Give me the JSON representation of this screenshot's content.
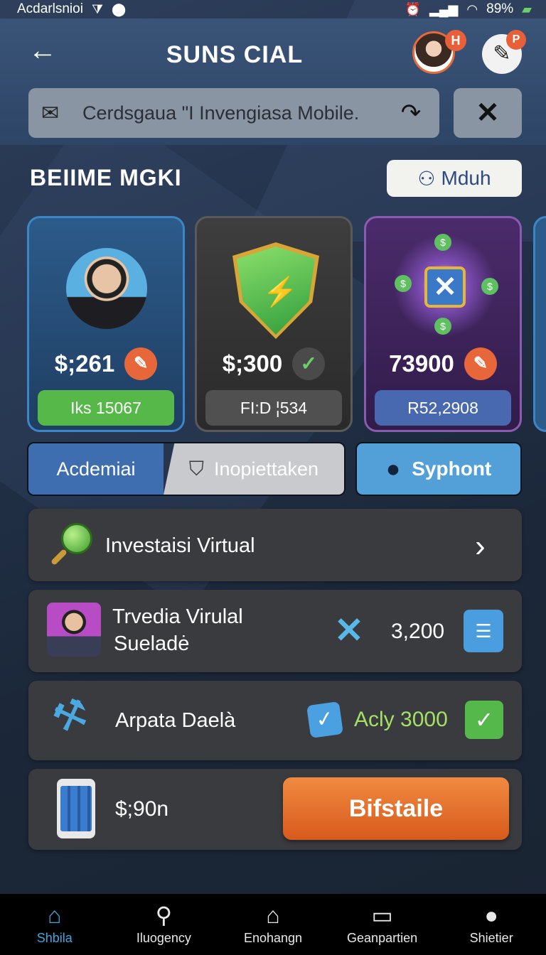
{
  "status_bar": {
    "carrier": "Acdarlsnioi",
    "battery": "89%"
  },
  "header": {
    "title": "SUNS CIAL",
    "avatar_badge": "H",
    "edit_badge": "P",
    "search": {
      "value": "Cerdsgaua \"I Invengiasa Mobile."
    }
  },
  "section": {
    "title": "BEIIME MGKI",
    "action_label": "Mduh"
  },
  "cards": [
    {
      "amount": "$;261",
      "pill": "Iks 15067"
    },
    {
      "amount": "$;300",
      "pill": "FI:D ¦534"
    },
    {
      "amount": "73900",
      "pill": "R52,2908"
    }
  ],
  "tabs": {
    "first": "Acdemiai",
    "second": "Inopiettaken",
    "third": "Syphont"
  },
  "rows": {
    "investasi": "Investaisi Virtual",
    "trvedia": {
      "line1": "Trvedia Virulal",
      "line2": "Sueladė",
      "value": "3,200"
    },
    "arpata": {
      "label": "Arpata Daelà",
      "value": "Acly 3000"
    },
    "purchase": {
      "amount": "$;90n",
      "button": "Bifstaile"
    }
  },
  "bottom_nav": [
    {
      "label": "Shbila",
      "icon": "home-icon",
      "active": true
    },
    {
      "label": "Iluogency",
      "icon": "search-icon",
      "active": false
    },
    {
      "label": "Enohangn",
      "icon": "house-icon",
      "active": false
    },
    {
      "label": "Geanpartien",
      "icon": "tablet-icon",
      "active": false
    },
    {
      "label": "Shietier",
      "icon": "profile-icon",
      "active": false
    }
  ],
  "colors": {
    "accent": "#3aa8e0",
    "cta": "#e8673a",
    "success": "#57b84a"
  }
}
